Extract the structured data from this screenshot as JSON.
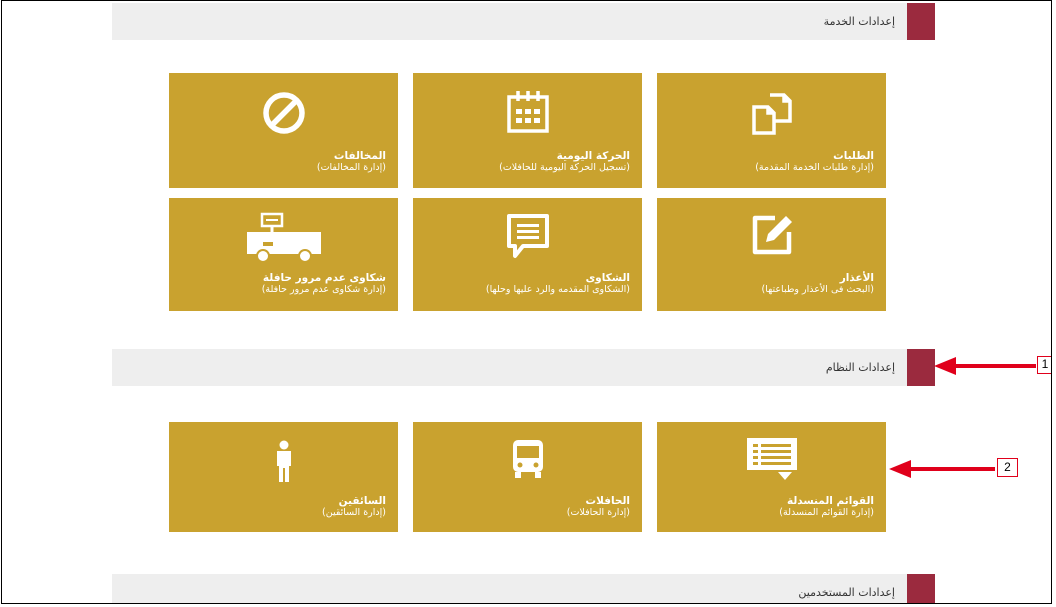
{
  "sections": {
    "service_settings": "إعدادات الخدمة",
    "system_settings": "إعدادات النظام",
    "user_settings": "إعدادات المستخدمين"
  },
  "tiles": {
    "requests": {
      "name": "الطلبات",
      "sub": "(إدارة طلبات الخدمة المقدمة)",
      "icon": "copy-documents-icon"
    },
    "daily_movement": {
      "name": "الحركة اليومية",
      "sub": "(تسجيل الحركة اليومية للحافلات)",
      "icon": "calendar-icon"
    },
    "violations": {
      "name": "المخالفات",
      "sub": "(إدارة المخالفات)",
      "icon": "prohibited-icon"
    },
    "excuses": {
      "name": "الأعذار",
      "sub": "(البحث فى الأعذار وطباعتها)",
      "icon": "edit-note-icon"
    },
    "complaints": {
      "name": "الشكاوى",
      "sub": "(الشكاوى المقدمه والرد عليها وحلها)",
      "icon": "speech-bubble-icon"
    },
    "bus_pass_complaints": {
      "name": "شكاوى عدم مرور حافلة",
      "sub": "(إدارة شكاوى عدم مرور حافلة)",
      "icon": "truck-sign-icon"
    },
    "dropdown_lists": {
      "name": "القوائم المنسدلة",
      "sub": "(إدارة القوائم المنسدلة)",
      "icon": "dropdown-list-icon"
    },
    "buses": {
      "name": "الحافلات",
      "sub": "(إدارة الحافلات)",
      "icon": "bus-icon"
    },
    "drivers": {
      "name": "السائقين",
      "sub": "(إدارة السائقين)",
      "icon": "person-icon"
    }
  },
  "annotations": {
    "callout_1": "1",
    "callout_2": "2"
  },
  "colors": {
    "tile": "#c9a22f",
    "accent": "#9b2a3e",
    "arrow": "#e0001b",
    "header_bg": "#eeeeee"
  }
}
